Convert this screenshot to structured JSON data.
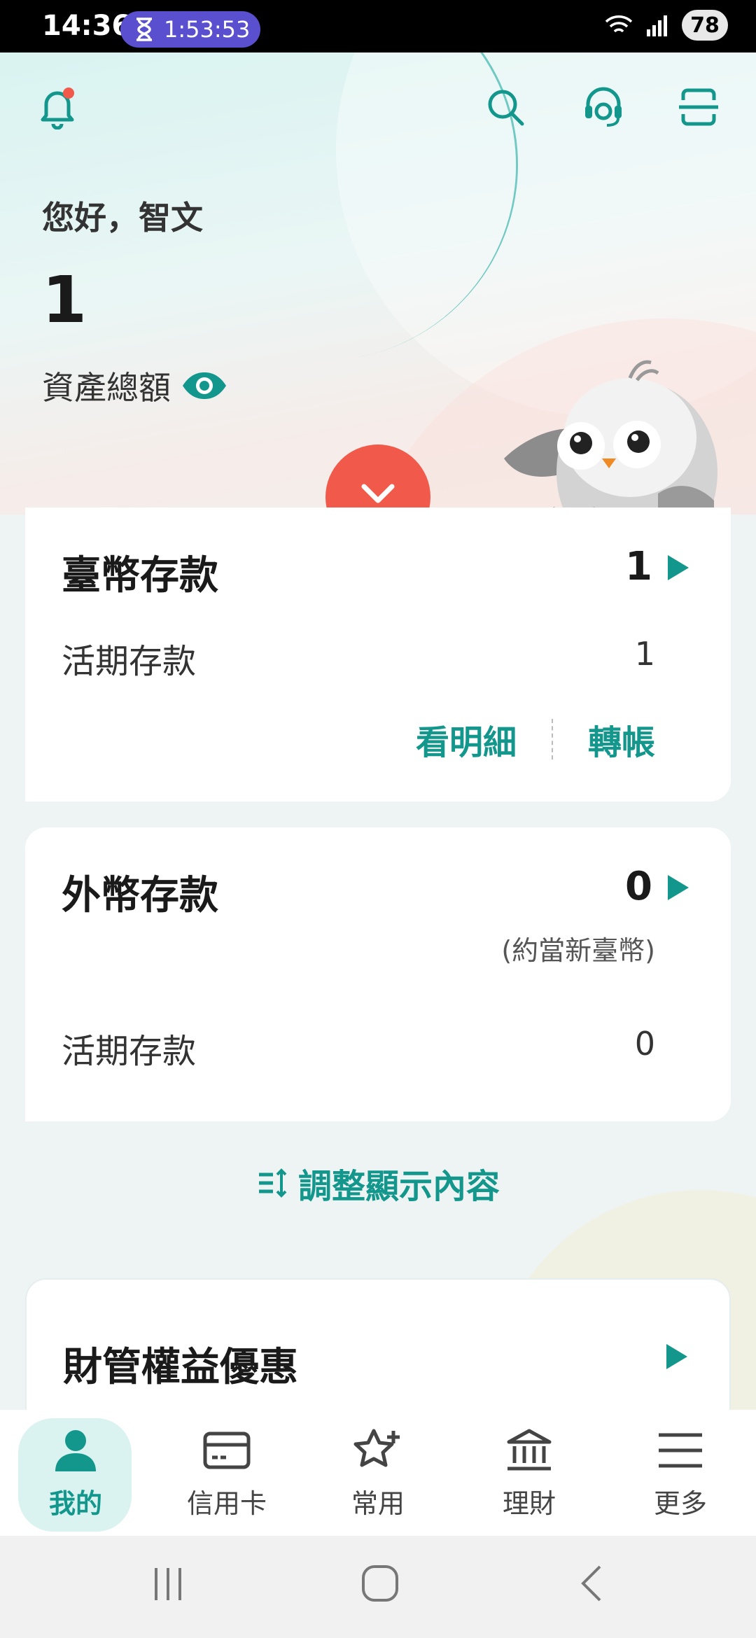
{
  "status_bar": {
    "time": "14:36",
    "timer": "1:53:53",
    "battery": "78"
  },
  "header": {
    "greeting": "您好，智文",
    "balance": "1",
    "asset_label": "資產總額"
  },
  "twd_deposit": {
    "title": "臺幣存款",
    "total": "1",
    "row_label": "活期存款",
    "row_value": "1",
    "actions": {
      "details": "看明細",
      "transfer": "轉帳"
    }
  },
  "fx_deposit": {
    "title": "外幣存款",
    "total": "0",
    "note": "(約當新臺幣)",
    "row_label": "活期存款",
    "row_value": "0"
  },
  "adjust_label": "調整顯示內容",
  "promo": {
    "title": "財管權益優惠"
  },
  "bottom_nav": [
    {
      "label": "我的",
      "icon": "person-icon",
      "active": true
    },
    {
      "label": "信用卡",
      "icon": "credit-card-icon"
    },
    {
      "label": "常用",
      "icon": "star-add-icon"
    },
    {
      "label": "理財",
      "icon": "bank-icon"
    },
    {
      "label": "更多",
      "icon": "menu-icon"
    }
  ],
  "colors": {
    "accent": "#13978c",
    "red": "#f15a4a",
    "timer": "#5a4fcf"
  }
}
